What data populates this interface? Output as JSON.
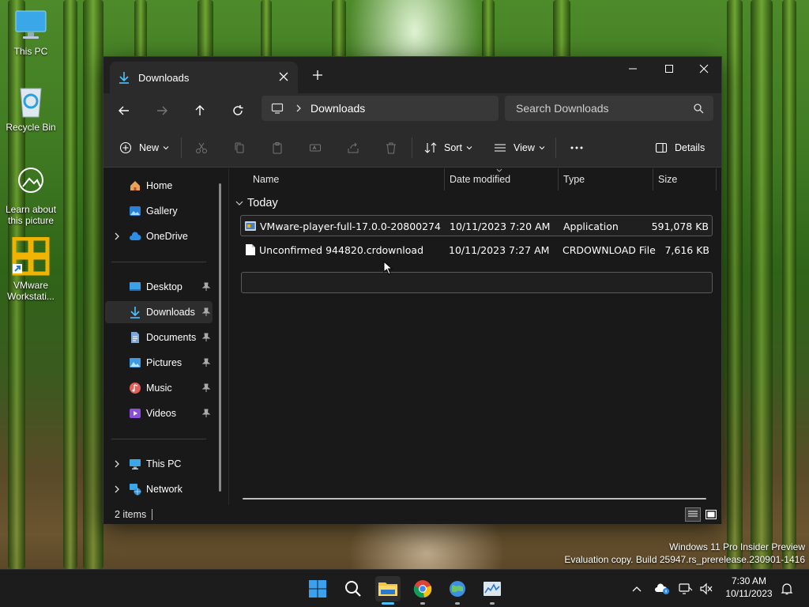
{
  "desktop": {
    "icons": [
      {
        "label": "This PC"
      },
      {
        "label": "Recycle Bin"
      },
      {
        "label": "Learn about this picture"
      },
      {
        "label": "VMware Workstati..."
      }
    ],
    "watermark": {
      "line1": "Windows 11 Pro Insider Preview",
      "line2": "Evaluation copy. Build 25947.rs_prerelease.230901-1416"
    }
  },
  "window": {
    "tab_title": "Downloads",
    "address": {
      "segment": "Downloads"
    },
    "search": {
      "placeholder": "Search Downloads"
    },
    "toolbar": {
      "new_label": "New",
      "sort_label": "Sort",
      "view_label": "View",
      "details_label": "Details"
    },
    "sidebar": {
      "home": "Home",
      "gallery": "Gallery",
      "onedrive": "OneDrive",
      "desktop": "Desktop",
      "downloads": "Downloads",
      "documents": "Documents",
      "pictures": "Pictures",
      "music": "Music",
      "videos": "Videos",
      "thispc": "This PC",
      "network": "Network"
    },
    "columns": {
      "name": "Name",
      "date": "Date modified",
      "type": "Type",
      "size": "Size"
    },
    "group": "Today",
    "files": [
      {
        "name": "VMware-player-full-17.0.0-20800274",
        "date": "10/11/2023 7:20 AM",
        "type": "Application",
        "size": "591,078 KB"
      },
      {
        "name": "Unconfirmed 944820.crdownload",
        "date": "10/11/2023 7:27 AM",
        "type": "CRDOWNLOAD File",
        "size": "7,616 KB"
      }
    ],
    "status": {
      "items": "2 items"
    }
  },
  "taskbar": {
    "clock_time": "7:30 AM",
    "clock_date": "10/11/2023"
  },
  "colors": {
    "accent": "#4cc2ff",
    "window_bg": "#191919",
    "toolbar_bg": "#2b2b2b"
  }
}
